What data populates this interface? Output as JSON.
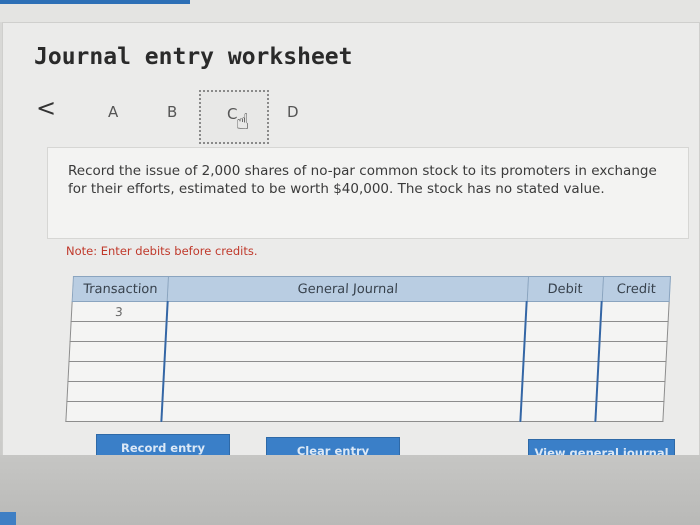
{
  "title": "Journal entry worksheet",
  "nav": {
    "back": "<",
    "tabs": [
      "A",
      "B",
      "C",
      "D"
    ],
    "active_tab": "C"
  },
  "question": "Record the issue of 2,000 shares of no-par common stock to its promoters in exchange for their efforts, estimated to be worth $40,000. The stock has no stated value.",
  "note": "Note: Enter debits before credits.",
  "table": {
    "headers": {
      "transaction": "Transaction",
      "general_journal": "General Journal",
      "debit": "Debit",
      "credit": "Credit"
    },
    "rows": [
      {
        "transaction": "3",
        "account": "",
        "debit": "",
        "credit": ""
      },
      {
        "transaction": "",
        "account": "",
        "debit": "",
        "credit": ""
      },
      {
        "transaction": "",
        "account": "",
        "debit": "",
        "credit": ""
      },
      {
        "transaction": "",
        "account": "",
        "debit": "",
        "credit": ""
      },
      {
        "transaction": "",
        "account": "",
        "debit": "",
        "credit": ""
      },
      {
        "transaction": "",
        "account": "",
        "debit": "",
        "credit": ""
      }
    ]
  },
  "buttons": {
    "record": "Record entry",
    "clear": "Clear entry",
    "view": "View general journal"
  },
  "colors": {
    "button_blue": "#3a7fc8",
    "header_blue": "#b9cde2",
    "note_red": "#c0392b"
  }
}
